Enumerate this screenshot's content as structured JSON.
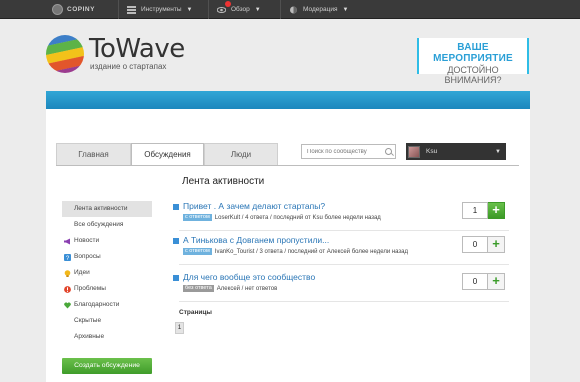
{
  "topbar": {
    "brand": "COPINY",
    "menu": [
      {
        "label": "Инструменты",
        "icon": "tools-icon"
      },
      {
        "label": "Обзор",
        "icon": "eye-icon"
      },
      {
        "label": "Модерация",
        "icon": "moderation-icon"
      }
    ]
  },
  "header": {
    "logo_title": "ToWave",
    "logo_subtitle": "издание о стартапах",
    "ad_line1": "ВАШЕ МЕРОПРИЯТИЕ",
    "ad_line2": "ДОСТОЙНО ВНИМАНИЯ?"
  },
  "tabs": [
    {
      "label": "Главная",
      "active": false
    },
    {
      "label": "Обсуждения",
      "active": true
    },
    {
      "label": "Люди",
      "active": false
    }
  ],
  "search": {
    "placeholder": "Поиск по сообществу"
  },
  "user": {
    "name": "Ksu"
  },
  "feed": {
    "title": "Лента активности"
  },
  "sidebar": {
    "items": [
      {
        "label": "Лента активности",
        "icon": "",
        "active": true
      },
      {
        "label": "Все обсуждения",
        "icon": ""
      },
      {
        "label": "Новости",
        "icon": "megaphone-icon"
      },
      {
        "label": "Вопросы",
        "icon": "question-icon"
      },
      {
        "label": "Идеи",
        "icon": "lightbulb-icon"
      },
      {
        "label": "Проблемы",
        "icon": "problem-icon"
      },
      {
        "label": "Благодарности",
        "icon": "heart-icon"
      },
      {
        "label": "Скрытые",
        "icon": ""
      },
      {
        "label": "Архивные",
        "icon": ""
      }
    ],
    "create_button": "Создать обсуждение"
  },
  "topics": [
    {
      "title": "Привет . А зачем делают стартапы?",
      "tag": "с ответом",
      "meta": "LoserKult / 4 ответа / последний от Ksu более недели назад",
      "votes": "1",
      "voted": true
    },
    {
      "title": "А Тинькова с Довганем пропустили...",
      "tag": "с ответом",
      "meta": "IvanKo_Tourist / 3 ответа / последний от Алексей более недели назад",
      "votes": "0",
      "voted": false
    },
    {
      "title": "Для чего вообще это сообщество",
      "tag": "без ответа",
      "meta": "Алексей / нет ответов",
      "votes": "0",
      "voted": false
    }
  ],
  "pagination": {
    "label": "Страницы",
    "current": "1"
  },
  "colors": {
    "accent_blue": "#1c87bd",
    "link": "#2a76b6",
    "green": "#3f9c2a"
  }
}
